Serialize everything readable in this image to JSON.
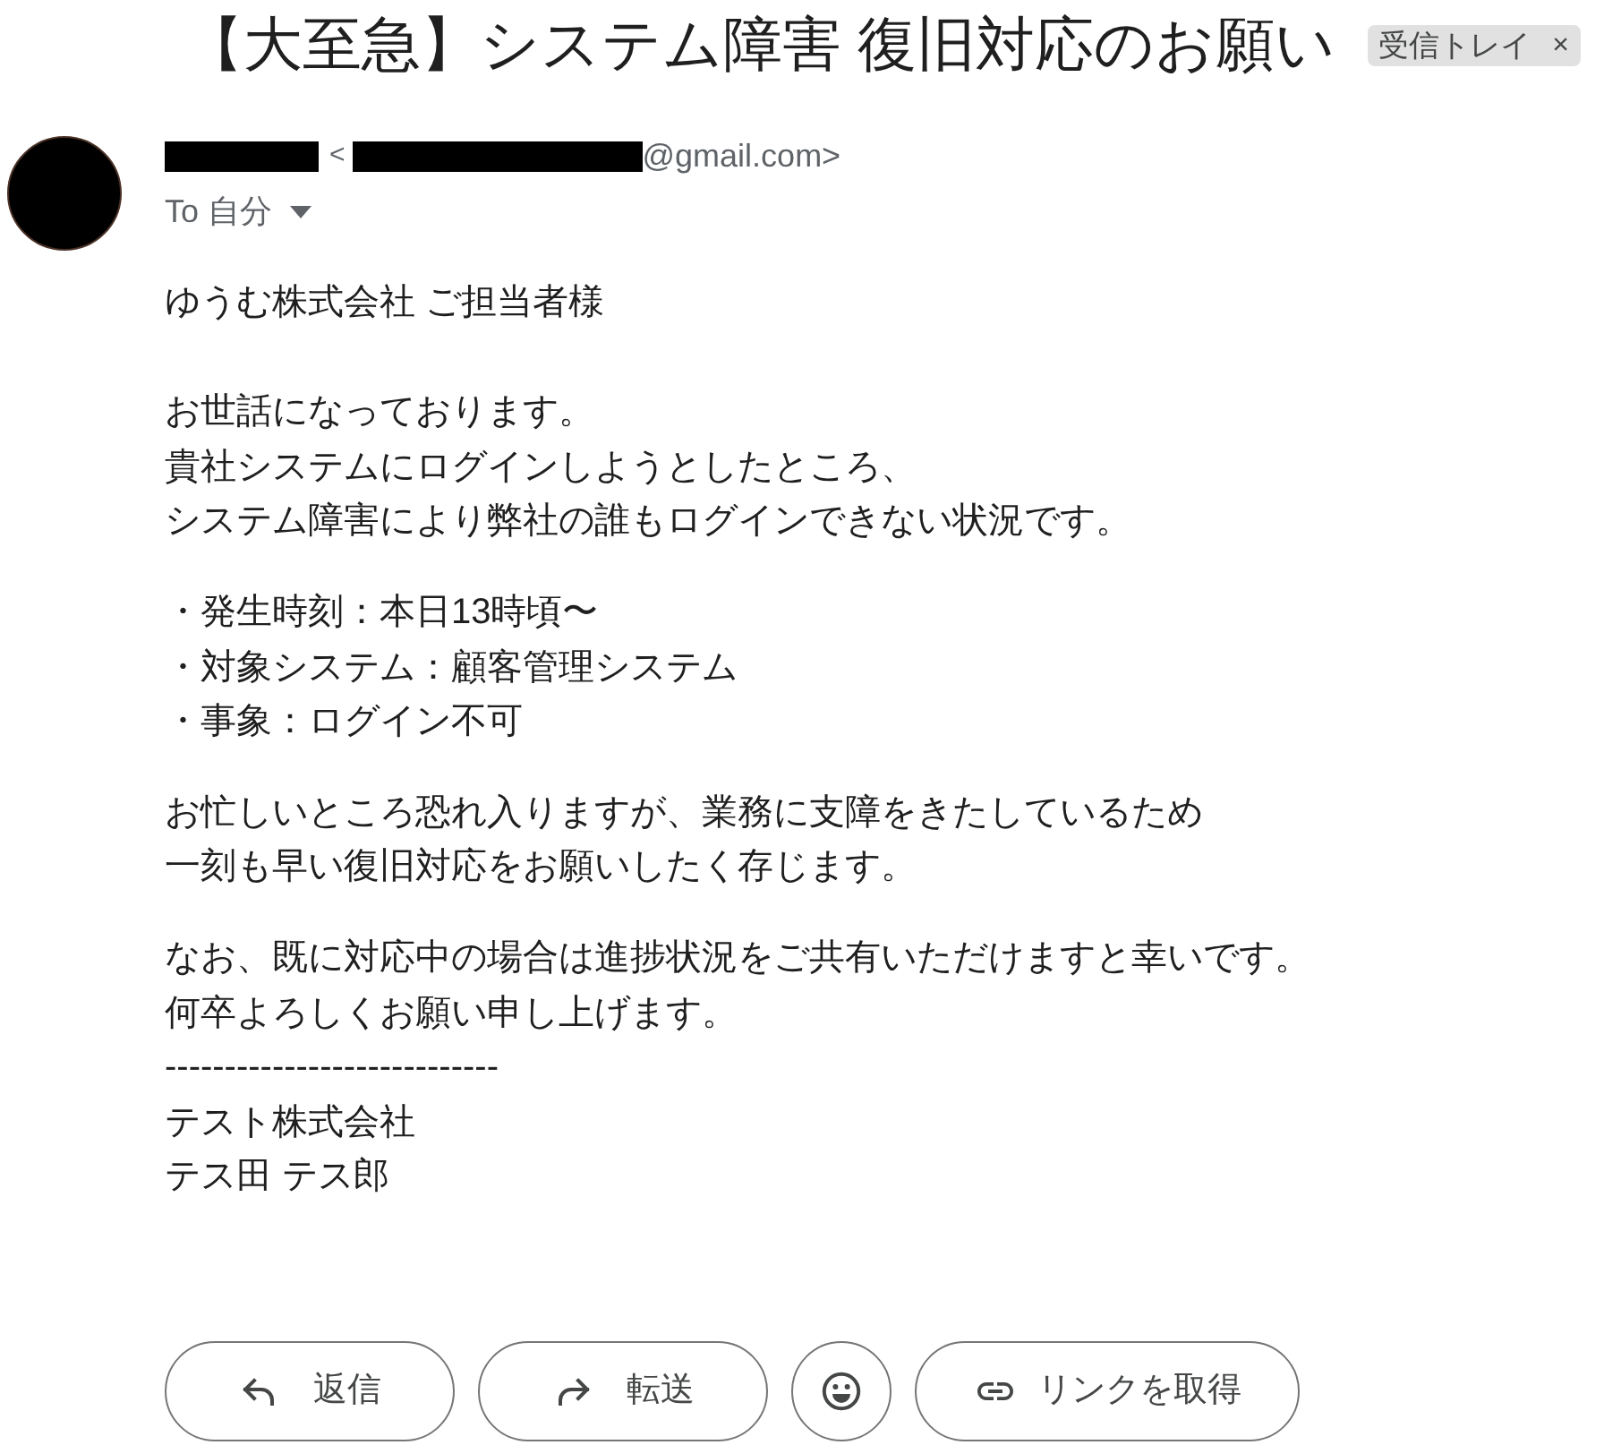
{
  "subject": "【大至急】システム障害 復旧対応のお願い",
  "labels": [
    {
      "text": "受信トレイ",
      "remove": "×"
    }
  ],
  "sender": {
    "email_open": "<",
    "email_domain": "@gmail.com>"
  },
  "recipient": "To 自分",
  "greeting": "ゆうむ株式会社 ご担当者様",
  "paragraphs": [
    [
      "お世話になっております。",
      "貴社システムにログインしようとしたところ、",
      "システム障害により弊社の誰もログインできない状況です。"
    ],
    [
      "・発生時刻：本日13時頃〜",
      "・対象システム：顧客管理システム",
      "・事象：ログイン不可"
    ],
    [
      "お忙しいところ恐れ入りますが、業務に支障をきたしているため",
      "一刻も早い復旧対応をお願いしたく存じます。"
    ],
    [
      "なお、既に対応中の場合は進捗状況をご共有いただけますと幸いです。",
      "何卒よろしくお願い申し上げます。",
      "----------------------------",
      "テスト株式会社",
      "テス田 テス郎"
    ]
  ],
  "actions": [
    {
      "kind": "reply",
      "label": "返信"
    },
    {
      "kind": "forward",
      "label": "転送"
    },
    {
      "kind": "emoji"
    },
    {
      "kind": "link",
      "label": "リンクを取得"
    }
  ]
}
